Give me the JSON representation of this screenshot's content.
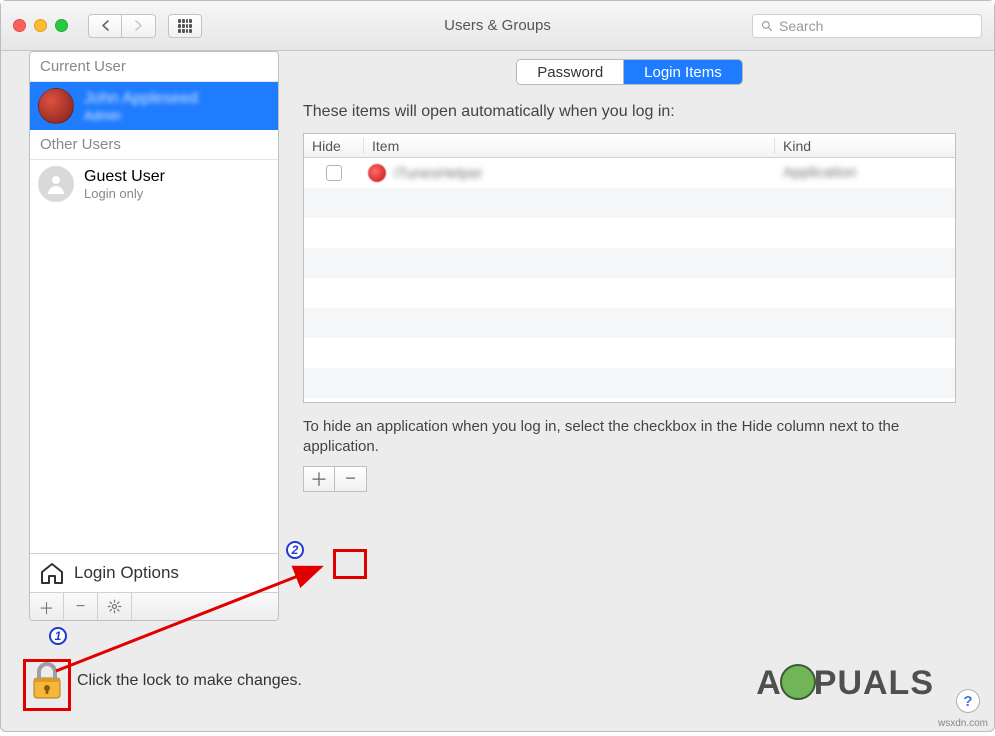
{
  "window": {
    "title": "Users & Groups",
    "search_placeholder": "Search"
  },
  "sidebar": {
    "current_user_header": "Current User",
    "other_users_header": "Other Users",
    "selected_user": {
      "name": "John Appleseed",
      "role": "Admin"
    },
    "guest_user": {
      "name": "Guest User",
      "role": "Login only"
    },
    "login_options_label": "Login Options"
  },
  "tabs": {
    "password": "Password",
    "login_items": "Login Items",
    "active": "login_items"
  },
  "login_items": {
    "intro": "These items will open automatically when you log in:",
    "columns": {
      "hide": "Hide",
      "item": "Item",
      "kind": "Kind"
    },
    "rows": [
      {
        "hide": false,
        "item": "iTunesHelper",
        "kind": "Application"
      }
    ],
    "hint": "To hide an application when you log in, select the checkbox in the Hide column next to the application."
  },
  "lock": {
    "text": "Click the lock to make changes."
  },
  "annotations": {
    "marker1": "1",
    "marker2": "2"
  },
  "watermark": {
    "brand_left": "A",
    "brand_right": "PUALS",
    "url": "wsxdn.com"
  }
}
